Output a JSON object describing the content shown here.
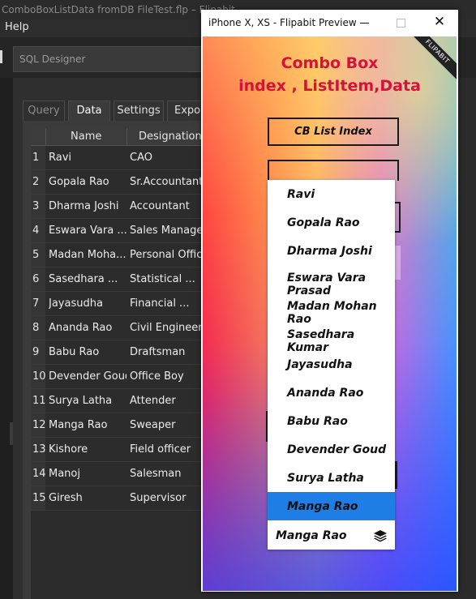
{
  "background_app": {
    "window_title": "ComboBoxListData fromDB FileTest.flp – Flipabit",
    "menu": [
      "Help"
    ],
    "sql_designer_placeholder": "SQL Designer",
    "tabs": [
      "Query",
      "Data",
      "Settings",
      "Expor"
    ],
    "active_tab": "Data",
    "grid": {
      "columns": [
        "Name",
        "Designation"
      ],
      "rows": [
        {
          "num": "1",
          "name": "Ravi",
          "designation": "CAO"
        },
        {
          "num": "2",
          "name": "Gopala Rao",
          "designation": "Sr.Accountant"
        },
        {
          "num": "3",
          "name": "Dharma Joshi",
          "designation": "Accountant"
        },
        {
          "num": "4",
          "name": "Eswara Vara ...",
          "designation": "Sales Manager"
        },
        {
          "num": "5",
          "name": "Madan Moha...",
          "designation": "Personal Office"
        },
        {
          "num": "6",
          "name": "Sasedhara ...",
          "designation": "Statistical ..."
        },
        {
          "num": "7",
          "name": "Jayasudha",
          "designation": "Financial ..."
        },
        {
          "num": "8",
          "name": "Ananda Rao",
          "designation": "Civil Engineer"
        },
        {
          "num": "9",
          "name": "Babu Rao",
          "designation": "Draftsman"
        },
        {
          "num": "10",
          "name": "Devender Goud",
          "designation": "Office Boy"
        },
        {
          "num": "11",
          "name": "Surya Latha",
          "designation": "Attender"
        },
        {
          "num": "12",
          "name": "Manga Rao",
          "designation": "Sweaper"
        },
        {
          "num": "13",
          "name": "Kishore",
          "designation": "Field officer"
        },
        {
          "num": "14",
          "name": "Manoj",
          "designation": "Salesman"
        },
        {
          "num": "15",
          "name": "Giresh",
          "designation": "Supervisor"
        }
      ]
    }
  },
  "preview": {
    "window_title": "iPhone X, XS - Flipabit Preview",
    "ribbon_text": "FLIPABIT",
    "heading_line1": "Combo Box",
    "heading_line2": "index , ListItem,Data",
    "cb_list_index_label": "CB List Index",
    "dropdown_items": [
      "Ravi",
      "Gopala Rao",
      "Dharma Joshi",
      "Eswara Vara Prasad",
      "Madan Mohan Rao",
      "Sasedhara Kumar",
      "Jayasudha",
      "Ananda Rao",
      "Babu Rao",
      "Devender Goud",
      "Surya Latha",
      "Manga Rao"
    ],
    "selected_item": "Manga Rao",
    "combo_value": "Manga Rao",
    "combo_icon": "layers-icon",
    "colors": {
      "heading": "#d6123a",
      "selected": "#1e7ee6"
    }
  }
}
